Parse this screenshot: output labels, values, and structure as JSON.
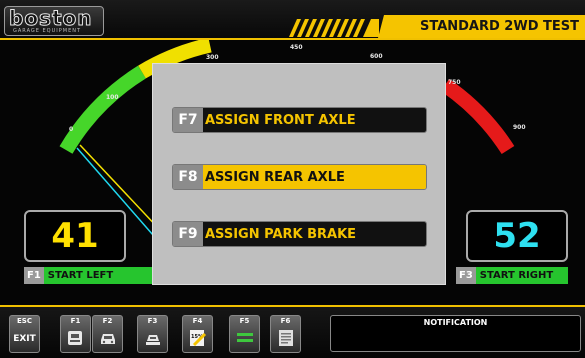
{
  "header": {
    "logo_main": "boston",
    "logo_sub": "GARAGE EQUIPMENT",
    "test_title": "STANDARD 2WD TEST",
    "accent_color": "#f5c400"
  },
  "gauge": {
    "scale_labels": [
      "0",
      "100",
      "300",
      "450",
      "600",
      "750",
      "900"
    ],
    "left_value": "41",
    "right_value": "52"
  },
  "controls": {
    "start_left": {
      "key": "F1",
      "label": "START LEFT"
    },
    "start_right": {
      "key": "F3",
      "label": "START RIGHT"
    }
  },
  "dialog": {
    "options": [
      {
        "key": "F7",
        "label": "ASSIGN FRONT AXLE",
        "active": false
      },
      {
        "key": "F8",
        "label": "ASSIGN REAR AXLE",
        "active": true
      },
      {
        "key": "F9",
        "label": "ASSIGN PARK BRAKE",
        "active": false
      }
    ]
  },
  "footer": {
    "keys": [
      {
        "key": "ESC",
        "text": "EXIT",
        "icon": "exit-icon"
      },
      {
        "key": "F1",
        "icon": "car-side-icon"
      },
      {
        "key": "F2",
        "icon": "car-front-icon"
      },
      {
        "key": "F3",
        "icon": "car-lift-icon"
      },
      {
        "key": "F4",
        "icon": "edit-percent-icon",
        "icon_text": "15%"
      },
      {
        "key": "F5",
        "icon": "toggle-bars-icon"
      },
      {
        "key": "F6",
        "icon": "document-icon"
      }
    ],
    "notification_title": "NOTIFICATION"
  }
}
